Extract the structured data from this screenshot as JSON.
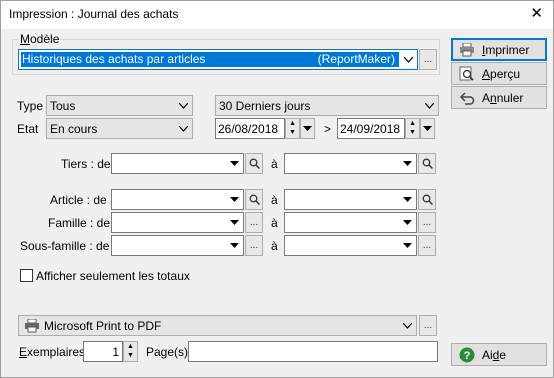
{
  "window": {
    "title": "Impression : Journal des achats",
    "close_glyph": "✕"
  },
  "modele": {
    "legend": "Modèle",
    "selected_name": "Historiques des achats par articles",
    "selected_source": "(ReportMaker)",
    "more": "..."
  },
  "buttons": {
    "imprimer": "Imprimer",
    "apercu": "Aperçu",
    "annuler": "Annuler",
    "aide": "Aide"
  },
  "filters": {
    "type_label": "Type",
    "type_value": "Tous",
    "etat_label": "Etat",
    "etat_value": "En cours",
    "period_value": "30 Derniers jours",
    "date_from": "26/08/2018",
    "date_sep": ">",
    "date_to": "24/09/2018"
  },
  "ranges": {
    "tiers_label": "Tiers : de",
    "article_label": "Article : de",
    "famille_label": "Famille : de",
    "sousfamille_label": "Sous-famille : de",
    "to_label": "à",
    "more": "..."
  },
  "totals_checkbox": {
    "label": "Afficher seulement les totaux",
    "checked": false
  },
  "printer": {
    "name": "Microsoft Print to PDF",
    "more": "..."
  },
  "copies": {
    "label": "Exemplaires",
    "value": "1",
    "pages_label": "Page(s)",
    "pages_value": ""
  },
  "colors": {
    "accent": "#0078d7",
    "selection_bg": "#0078d7",
    "help_green": "#2e8b3e"
  }
}
